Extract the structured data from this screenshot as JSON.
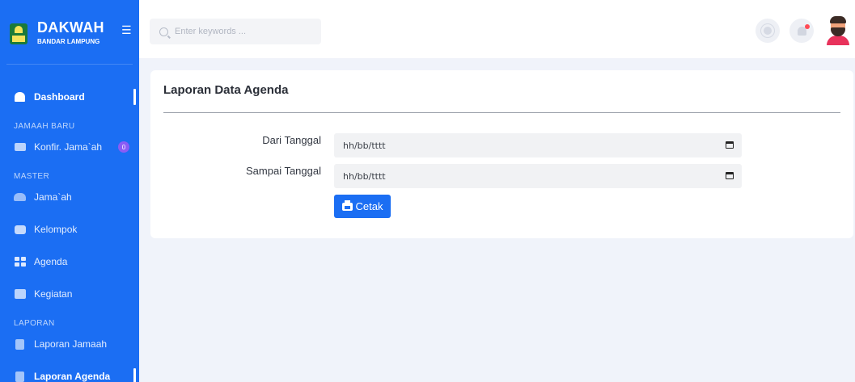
{
  "brand": {
    "title": "DAKWAH",
    "subtitle": "BANDAR LAMPUNG"
  },
  "search": {
    "placeholder": "Enter keywords ..."
  },
  "sidebar": {
    "dashboard": "Dashboard",
    "section_jamaah_baru": "JAMAAH BARU",
    "konfir": "Konfir. Jama`ah",
    "konfir_badge": "0",
    "section_master": "MASTER",
    "jamaah": "Jama`ah",
    "kelompok": "Kelompok",
    "agenda": "Agenda",
    "kegiatan": "Kegiatan",
    "section_laporan": "LAPORAN",
    "laporan_jamaah": "Laporan Jamaah",
    "laporan_agenda": "Laporan Agenda"
  },
  "page": {
    "title": "Laporan Data Agenda",
    "from_label": "Dari Tanggal",
    "from_value": "hh/bb/tttt",
    "to_label": "Sampai Tanggal",
    "to_value": "hh/bb/tttt",
    "print_button": "Cetak"
  },
  "colors": {
    "primary": "#1b6ef3",
    "badge": "#8a5cf5",
    "notification_dot": "#ff4b55"
  }
}
